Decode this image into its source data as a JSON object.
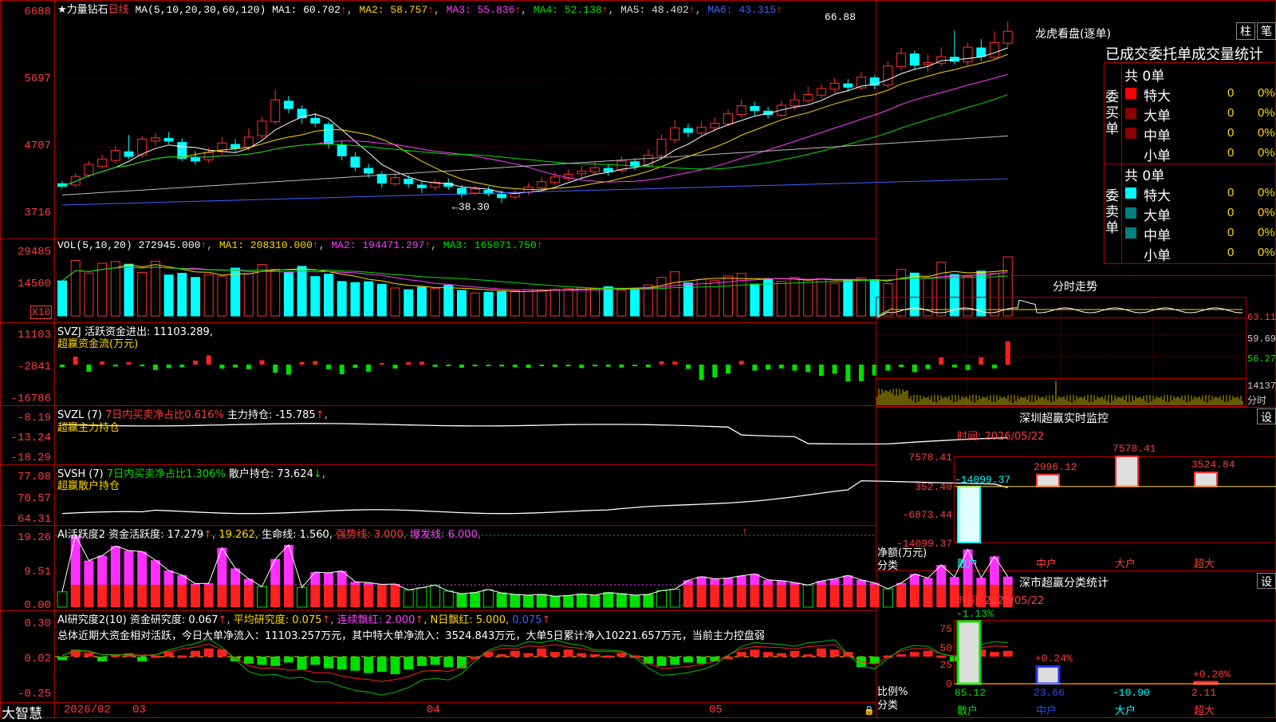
{
  "stock": {
    "name": "★力量钻石",
    "period": "日线",
    "ma_label": "MA(5,10,20,30,60,120)",
    "ma": [
      {
        "label": "MA1: 60.702",
        "color": "#ffffff"
      },
      {
        "label": "MA2: 58.757",
        "color": "#ffd700"
      },
      {
        "label": "MA3: 55.836",
        "color": "#ff3bff"
      },
      {
        "label": "MA4: 52.138",
        "color": "#00e000"
      },
      {
        "label": "MA5: 48.402",
        "color": "#bbbbbb"
      },
      {
        "label": "MA6: 43.315",
        "color": "#4060ff"
      }
    ],
    "high_note": "66.88",
    "low_note": "←38.30"
  },
  "axes": {
    "price": [
      "6688",
      "5697",
      "4707",
      "3716"
    ],
    "vol": [
      "29485",
      "14560"
    ],
    "vol_unit": "X10",
    "svzj": [
      "11103",
      "-2841",
      "-16786"
    ],
    "svzl": [
      "-8.19",
      "-13.24",
      "-18.29"
    ],
    "svsh": [
      "77.08",
      "70.57",
      "64.31"
    ],
    "ai1": [
      "19.26",
      "9.51",
      "0.00"
    ],
    "ai2": [
      "0.30",
      "0.02",
      "-0.25"
    ]
  },
  "vol_panel": {
    "title": "VOL(5,10,20)",
    "value": "272945.000",
    "ma1": "MA1: 208310.000",
    "ma2": "MA2: 194471.297",
    "ma3": "MA3: 165071.750"
  },
  "svzj_panel": {
    "title": "SVZJ  活跃资金进出: 11103.289",
    "sub": "超赢资金流(万元)"
  },
  "svzl_panel": {
    "title": "SVZL (7)",
    "ratio": "7日内买卖净占比0.616%",
    "hold": "主力持仓: -15.785",
    "sub": "超赢主力持仓"
  },
  "svsh_panel": {
    "title": "SVSH (7)",
    "ratio": "7日内买卖净占比1.306%",
    "hold": "散户持仓: 73.624",
    "sub": "超赢散户持仓"
  },
  "ai1_panel": {
    "title": "AI活跃度2 资金活跃度: 17.279",
    "v2": "19.262,",
    "life": "生命线: 1.560,",
    "strong": "强势线: 3.000,",
    "burst": "爆发线: 6.000,"
  },
  "ai2_panel": {
    "title": "AI研究度2(10) 资金研究度: 0.067",
    "avg": "平均研究度: 0.075",
    "red1": "连续飘红: 2.000",
    "redn": "N日飘红: 5.000,",
    "last": "0.075",
    "summary": "总体近期大资金相对活跃，今日大单净流入：11103.257万元，其中特大单净流入：3524.843万元，大单5日累计净入10221.657万元，当前主力控盘弱"
  },
  "bottom": {
    "logo": "大智慧",
    "dates": [
      "2026/02",
      "03",
      "04",
      "05"
    ]
  },
  "right": {
    "title": "龙虎看盘(逐单)",
    "btn_col": "柱",
    "btn_pen": "笔",
    "tabs": "已成交委托单成交量统计",
    "buy_group": "委买单",
    "sell_group": "委卖单",
    "buy_total": "共 0单",
    "sell_total": "共 0单",
    "buy_rows": [
      {
        "label": "特大",
        "count": "0",
        "pct": "0%",
        "color": "#ff0000"
      },
      {
        "label": "大单",
        "count": "0",
        "pct": "0%",
        "color": "#8b0000"
      },
      {
        "label": "中单",
        "count": "0",
        "pct": "0%",
        "color": "#8b0000"
      },
      {
        "label": "小单",
        "count": "0",
        "pct": "0%",
        "color": ""
      }
    ],
    "sell_rows": [
      {
        "label": "特大",
        "count": "0",
        "pct": "0%",
        "color": "#00ffff"
      },
      {
        "label": "大单",
        "count": "0",
        "pct": "0%",
        "color": "#008080"
      },
      {
        "label": "中单",
        "count": "0",
        "pct": "0%",
        "color": "#008080"
      },
      {
        "label": "小单",
        "count": "0",
        "pct": "0%",
        "color": ""
      }
    ],
    "intraday_title": "分时走势",
    "intraday_axis": [
      "63.11",
      "59.69",
      "56.27",
      "14137",
      "分时"
    ],
    "monitor_title": "深圳超赢实时监控",
    "monitor_btn": "设",
    "monitor_time": "时间: 2026/05/22",
    "monitor_axis": [
      "7578.41",
      "352.40",
      "-6873.44",
      "-14099.37"
    ],
    "monitor_ylabel": "净额(万元)",
    "monitor_xlabel": "分类",
    "stats_title": "深市超赢分类统计",
    "stats_btn": "设",
    "stats_time": "时间: 2026/05/22",
    "stats_axis": [
      "75",
      "50",
      "25",
      "0"
    ],
    "stats_ylabel": "比例%",
    "stats_xlabel": "分类"
  },
  "monitor_chart": {
    "type": "bar",
    "categories": [
      "散户",
      "中户",
      "大户",
      "超大"
    ],
    "values": [
      -14099.37,
      2996.12,
      7578.41,
      3524.84
    ],
    "labels": [
      "-14099.37",
      "2996.12",
      "7578.41",
      "3524.84"
    ],
    "ylim": [
      -14099.37,
      7578.41
    ]
  },
  "stats_chart": {
    "type": "bar",
    "categories": [
      "散户",
      "中户",
      "大户",
      "超大"
    ],
    "values": [
      85.12,
      23.66,
      -10.9,
      2.11
    ],
    "value_labels": [
      "85.12",
      "23.66",
      "-10.90",
      "2.11"
    ],
    "change_labels": [
      "-1.13%",
      "+0.24%",
      "",
      "+0.28%"
    ],
    "ylim": [
      0,
      85
    ]
  },
  "chart_data": {
    "type": "bar",
    "title": "力量钻石 日线",
    "categories": [
      "2026/02",
      "03",
      "04",
      "05"
    ],
    "price_ylim": [
      37.16,
      66.88
    ],
    "candles": [
      [
        41.2,
        40.8,
        41.6,
        40.5
      ],
      [
        41.0,
        42.3,
        42.8,
        40.7
      ],
      [
        42.5,
        44.1,
        44.6,
        42.1
      ],
      [
        43.8,
        44.9,
        45.6,
        43.5
      ],
      [
        44.7,
        46.2,
        46.9,
        44.2
      ],
      [
        46.0,
        45.3,
        48.5,
        44.9
      ],
      [
        45.5,
        47.9,
        48.3,
        45.1
      ],
      [
        47.6,
        48.1,
        48.8,
        46.9
      ],
      [
        48.0,
        47.6,
        49.0,
        47.2
      ],
      [
        47.4,
        45.0,
        48.0,
        44.6
      ],
      [
        45.2,
        44.6,
        46.1,
        44.1
      ],
      [
        44.8,
        45.9,
        46.6,
        44.3
      ],
      [
        46.0,
        47.3,
        48.2,
        45.6
      ],
      [
        47.1,
        46.5,
        47.9,
        46.0
      ],
      [
        46.7,
        48.2,
        49.5,
        46.2
      ],
      [
        48.4,
        50.6,
        51.2,
        47.9
      ],
      [
        50.5,
        53.8,
        55.3,
        50.1
      ],
      [
        53.6,
        52.5,
        54.4,
        51.8
      ],
      [
        52.4,
        51.1,
        53.0,
        50.2
      ],
      [
        51.0,
        50.3,
        51.8,
        49.7
      ],
      [
        50.1,
        47.2,
        50.5,
        46.5
      ],
      [
        47.0,
        45.4,
        47.6,
        44.7
      ],
      [
        45.2,
        43.7,
        45.9,
        43.1
      ],
      [
        43.5,
        42.8,
        44.2,
        42.1
      ],
      [
        42.6,
        41.3,
        43.1,
        40.6
      ],
      [
        41.2,
        42.1,
        42.8,
        40.9
      ],
      [
        41.9,
        41.2,
        42.5,
        40.6
      ],
      [
        41.0,
        40.6,
        41.6,
        39.8
      ],
      [
        40.7,
        41.4,
        41.9,
        40.2
      ],
      [
        41.3,
        40.8,
        42.0,
        40.3
      ],
      [
        40.5,
        39.6,
        41.0,
        39.1
      ],
      [
        39.8,
        40.4,
        40.9,
        39.5
      ],
      [
        40.2,
        39.7,
        40.8,
        39.3
      ],
      [
        39.6,
        39.1,
        40.2,
        38.3
      ],
      [
        39.2,
        39.8,
        40.3,
        38.8
      ],
      [
        39.9,
        40.7,
        41.3,
        39.5
      ],
      [
        40.6,
        41.5,
        42.2,
        40.2
      ],
      [
        41.4,
        42.2,
        43.0,
        41.0
      ],
      [
        42.0,
        42.6,
        43.4,
        41.6
      ],
      [
        42.7,
        43.1,
        43.9,
        42.1
      ],
      [
        43.0,
        43.6,
        44.5,
        42.5
      ],
      [
        43.5,
        43.0,
        44.1,
        42.4
      ],
      [
        43.2,
        44.6,
        45.3,
        42.9
      ],
      [
        44.5,
        43.8,
        45.0,
        43.2
      ],
      [
        43.9,
        45.5,
        46.4,
        43.6
      ],
      [
        45.4,
        47.9,
        48.6,
        45.0
      ],
      [
        47.8,
        49.6,
        50.8,
        47.3
      ],
      [
        49.5,
        48.9,
        50.2,
        48.2
      ],
      [
        48.8,
        49.7,
        50.6,
        48.3
      ],
      [
        49.6,
        50.3,
        51.2,
        49.0
      ],
      [
        50.2,
        51.7,
        52.4,
        49.8
      ],
      [
        51.6,
        52.9,
        53.8,
        51.1
      ],
      [
        52.8,
        52.2,
        53.5,
        51.5
      ],
      [
        52.1,
        51.6,
        52.8,
        51.0
      ],
      [
        51.5,
        53.0,
        53.7,
        51.2
      ],
      [
        52.9,
        53.8,
        54.9,
        52.3
      ],
      [
        53.7,
        54.6,
        55.8,
        53.2
      ],
      [
        54.5,
        55.5,
        56.2,
        54.0
      ],
      [
        55.4,
        56.3,
        57.1,
        54.8
      ],
      [
        56.2,
        55.7,
        56.9,
        55.0
      ],
      [
        55.6,
        57.2,
        58.0,
        55.3
      ],
      [
        57.1,
        56.0,
        57.5,
        55.4
      ],
      [
        56.0,
        58.9,
        59.6,
        55.6
      ],
      [
        58.8,
        60.8,
        61.6,
        58.3
      ],
      [
        60.7,
        59.0,
        61.2,
        58.4
      ],
      [
        59.1,
        59.4,
        60.6,
        58.0
      ],
      [
        59.3,
        60.3,
        61.7,
        58.8
      ],
      [
        60.2,
        59.6,
        64.2,
        59.1
      ],
      [
        59.5,
        61.7,
        62.4,
        59.0
      ],
      [
        61.6,
        60.3,
        62.9,
        59.7
      ],
      [
        60.2,
        62.4,
        64.1,
        59.9
      ],
      [
        62.3,
        64.1,
        65.6,
        61.8
      ]
    ],
    "volume": [
      16200,
      25600,
      19800,
      24300,
      25100,
      23900,
      20100,
      25300,
      18900,
      19700,
      17800,
      19100,
      18400,
      22100,
      19600,
      23800,
      21600,
      20300,
      22900,
      18200,
      19300,
      15900,
      15400,
      15800,
      14600,
      12900,
      12100,
      13300,
      12600,
      14200,
      11800,
      10600,
      10900,
      11200,
      11600,
      12100,
      11900,
      12300,
      12600,
      13100,
      12700,
      13500,
      11900,
      12800,
      14300,
      17800,
      20400,
      15200,
      16900,
      16300,
      18400,
      19600,
      14700,
      17200,
      15900,
      17800,
      16900,
      17200,
      15100,
      16400,
      17600,
      16800,
      14900,
      21500,
      19800,
      17600,
      24800,
      19100,
      18300,
      20700,
      19600,
      27300
    ],
    "svzj": [
      -1200,
      3800,
      -3400,
      1500,
      -900,
      1200,
      -800,
      -2600,
      -1700,
      -1300,
      1900,
      4400,
      -1900,
      -1400,
      -2200,
      2100,
      -3900,
      -4800,
      1300,
      1700,
      -2200,
      -4600,
      -1600,
      -3400,
      800,
      -1900,
      1200,
      1400,
      -1100,
      -600,
      -1500,
      -800,
      -500,
      -900,
      -1300,
      -1600,
      -700,
      -1100,
      -800,
      -1700,
      -800,
      -1000,
      -1400,
      -600,
      -1300,
      1600,
      1400,
      -2100,
      -7300,
      -6100,
      -4300,
      1800,
      -2900,
      -2400,
      -1800,
      -2900,
      -3600,
      -5400,
      -4400,
      -8100,
      -7900,
      -5200,
      -2900,
      -1200,
      -3600,
      -2100,
      3400,
      -1400,
      -2600,
      3500,
      -1800,
      11103
    ],
    "ai1": [
      4.1,
      19.26,
      12.5,
      13.8,
      16.4,
      15.2,
      14.9,
      12.6,
      9.8,
      8.6,
      6.3,
      6.4,
      15.9,
      10.4,
      7.6,
      5.5,
      12.9,
      16.7,
      5.3,
      9.4,
      9.2,
      9.7,
      6.8,
      6.6,
      6.1,
      6.2,
      4.6,
      5.2,
      5.9,
      4.3,
      3.6,
      3.9,
      4.7,
      3.8,
      3.4,
      3.2,
      3.4,
      2.9,
      3.1,
      3.5,
      3.2,
      3.9,
      3.6,
      3.2,
      3.4,
      4.4,
      4.8,
      7.2,
      8.2,
      7.6,
      7.8,
      8.4,
      8.9,
      7.3,
      7.1,
      6.6,
      5.9,
      7.0,
      7.6,
      8.5,
      7.3,
      6.5,
      4.9,
      6.5,
      8.9,
      7.8,
      11.3,
      8.1,
      15.5,
      7.9,
      13.6,
      8.2
    ],
    "ai2": [
      -0.01,
      0.08,
      0.05,
      -0.02,
      0.04,
      0.05,
      -0.02,
      0.03,
      0.06,
      0.03,
      0.07,
      0.09,
      0.08,
      -0.02,
      -0.04,
      -0.05,
      -0.06,
      -0.03,
      -0.09,
      -0.05,
      -0.08,
      -0.09,
      -0.1,
      -0.12,
      -0.11,
      -0.13,
      -0.09,
      -0.06,
      -0.05,
      -0.07,
      -0.08,
      0.02,
      0.06,
      0.04,
      0.07,
      0.05,
      0.09,
      0.06,
      0.08,
      0.05,
      0.04,
      0.03,
      0.05,
      0.03,
      -0.04,
      -0.06,
      -0.05,
      -0.03,
      -0.04,
      -0.02,
      0.02,
      0.06,
      0.08,
      0.06,
      0.05,
      0.07,
      0.04,
      0.09,
      0.08,
      0.06,
      -0.07,
      -0.04,
      0.03,
      0.04,
      0.06,
      0.07,
      0.03,
      -0.02,
      0.04,
      0.08,
      0.06,
      0.07
    ]
  }
}
